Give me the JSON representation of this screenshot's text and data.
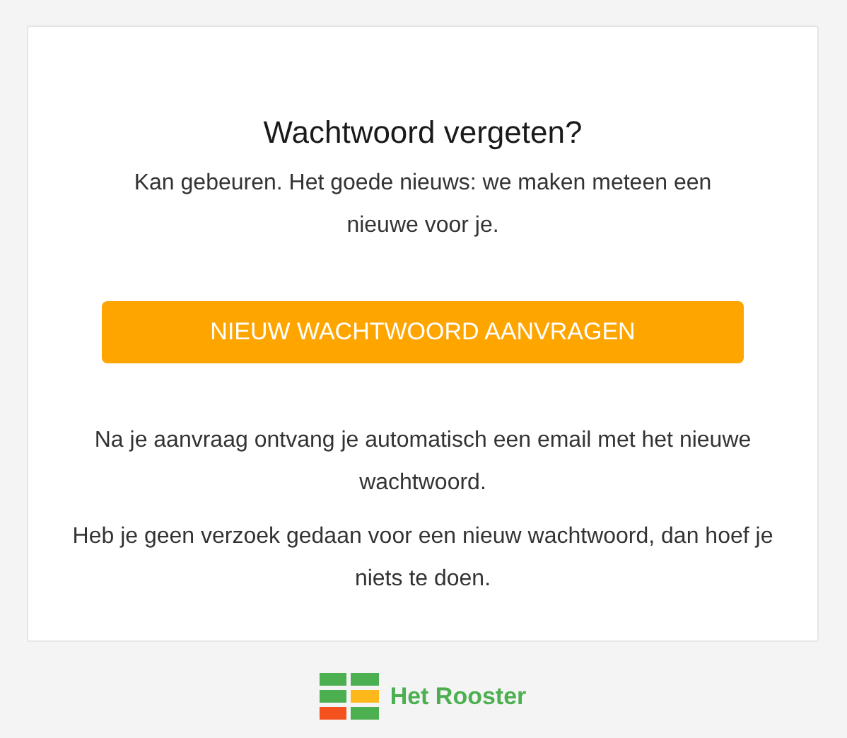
{
  "title": "Wachtwoord vergeten?",
  "intro": "Kan gebeuren. Het goede nieuws: we maken meteen een nieuwe voor je.",
  "button": "NIEUW WACHTWOORD AANVRAGEN",
  "paragraphs": [
    "Na je aanvraag ontvang je automatisch een email met het nieuwe wachtwoord.",
    "Heb je geen verzoek gedaan voor een nieuw wachtwoord, dan hoef je niets te doen."
  ],
  "brand": "Het Rooster"
}
